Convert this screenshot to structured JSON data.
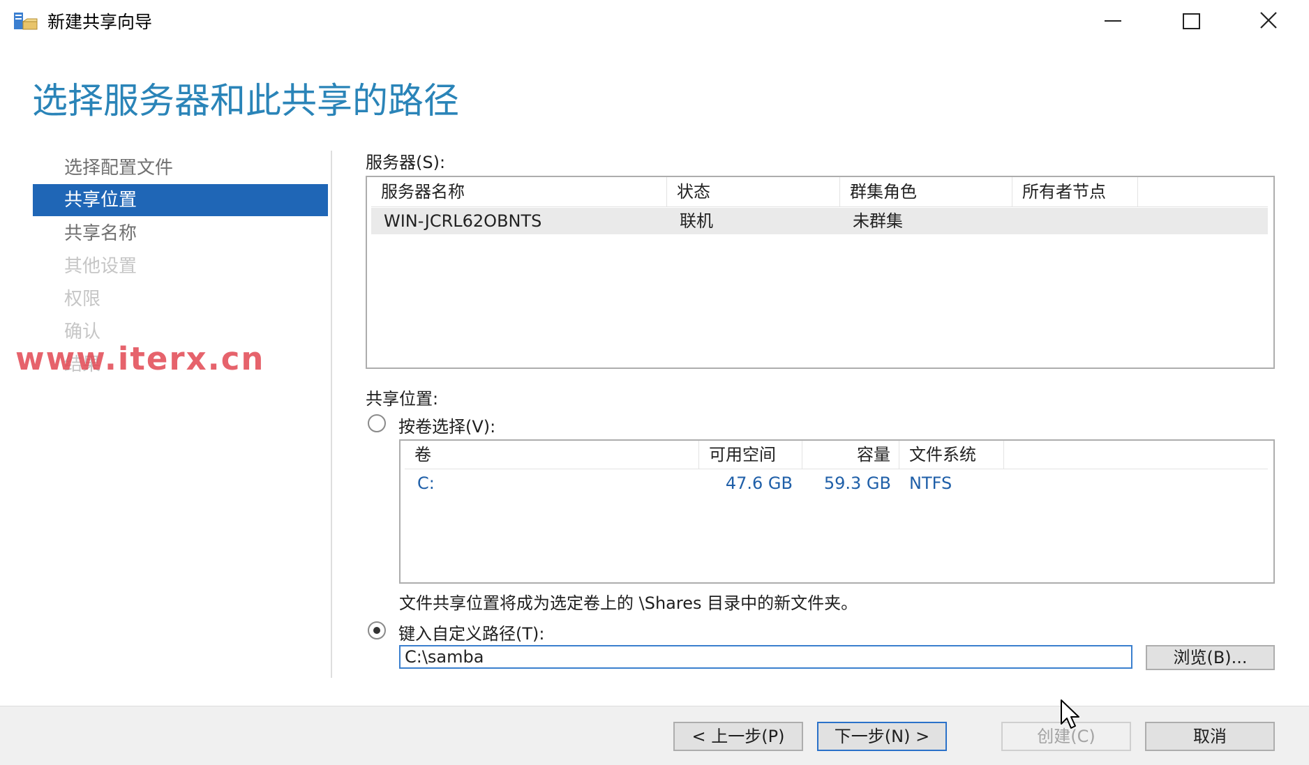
{
  "window": {
    "title": "新建共享向导"
  },
  "page": {
    "title": "选择服务器和此共享的路径"
  },
  "nav": {
    "items": [
      {
        "label": "选择配置文件",
        "state": "normal"
      },
      {
        "label": "共享位置",
        "state": "active"
      },
      {
        "label": "共享名称",
        "state": "normal"
      },
      {
        "label": "其他设置",
        "state": "disabled"
      },
      {
        "label": "权限",
        "state": "disabled"
      },
      {
        "label": "确认",
        "state": "disabled"
      },
      {
        "label": "结果",
        "state": "disabled"
      }
    ]
  },
  "servers": {
    "label": "服务器(S):",
    "columns": [
      "服务器名称",
      "状态",
      "群集角色",
      "所有者节点"
    ],
    "rows": [
      {
        "name": "WIN-JCRL62OBNTS",
        "status": "联机",
        "cluster_role": "未群集",
        "owner_node": ""
      }
    ]
  },
  "share_location": {
    "label": "共享位置:",
    "by_volume_label": "按卷选择(V):",
    "by_volume_selected": false,
    "volume_columns": [
      "卷",
      "可用空间",
      "容量",
      "文件系统"
    ],
    "volumes": [
      {
        "volume": "C:",
        "free": "47.6 GB",
        "capacity": "59.3 GB",
        "fs": "NTFS"
      }
    ],
    "volume_note": "文件共享位置将成为选定卷上的 \\Shares 目录中的新文件夹。",
    "custom_label": "键入自定义路径(T):",
    "custom_selected": true,
    "custom_path": "C:\\samba",
    "browse_label": "浏览(B)..."
  },
  "footer": {
    "prev_label": "< 上一步(P)",
    "next_label": "下一步(N) >",
    "create_label": "创建(C)",
    "cancel_label": "取消"
  },
  "watermark": "www.iterx.cn",
  "colors": {
    "accent": "#2a84b8",
    "nav_active": "#1f66b6",
    "volume_text": "#1f5fa8",
    "watermark": "#e24852"
  }
}
